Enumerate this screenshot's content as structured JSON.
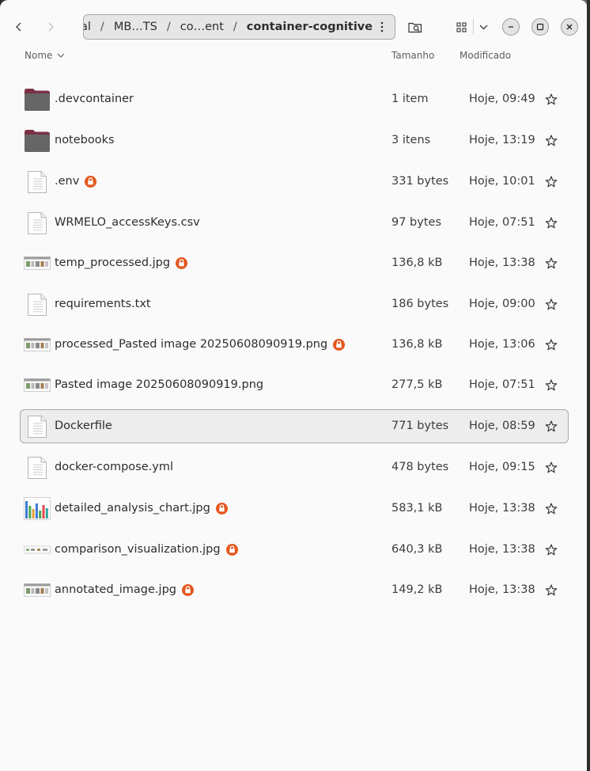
{
  "app": {
    "title": "container-cognitive",
    "accent": "#e5581f"
  },
  "header": {
    "back_icon": "chevron-left-icon",
    "forward_icon": "chevron-right-icon",
    "breadcrumb": [
      "al",
      "MB…TS",
      "co…ent",
      "container-cognitive"
    ],
    "separator": "/",
    "menu_icon": "vertical-dots-icon",
    "search_icon": "search-folder-icon",
    "view_icon": "grid-view-icon",
    "view_dropdown_icon": "chevron-down-icon",
    "window_controls": [
      "minimize-icon",
      "maximize-icon",
      "close-icon"
    ]
  },
  "columns": {
    "name": "Nome",
    "size": "Tamanho",
    "modified": "Modificado",
    "sort_icon": "chevron-down-icon"
  },
  "files": [
    {
      "name": ".devcontainer",
      "type": "folder",
      "size": "1 item",
      "modified": "Hoje, 09:49",
      "locked": false
    },
    {
      "name": "notebooks",
      "type": "folder",
      "size": "3 itens",
      "modified": "Hoje, 13:19",
      "locked": false
    },
    {
      "name": ".env",
      "type": "text",
      "size": "331 bytes",
      "modified": "Hoje, 10:01",
      "locked": true
    },
    {
      "name": "WRMELO_accessKeys.csv",
      "type": "text",
      "size": "97 bytes",
      "modified": "Hoje, 07:51",
      "locked": false
    },
    {
      "name": "temp_processed.jpg",
      "type": "image",
      "size": "136,8 kB",
      "modified": "Hoje, 13:38",
      "locked": true
    },
    {
      "name": "requirements.txt",
      "type": "text",
      "size": "186 bytes",
      "modified": "Hoje, 09:00",
      "locked": false
    },
    {
      "name": "processed_Pasted image 20250608090919.png",
      "type": "image",
      "size": "136,8 kB",
      "modified": "Hoje, 13:06",
      "locked": true
    },
    {
      "name": "Pasted image 20250608090919.png",
      "type": "image",
      "size": "277,5 kB",
      "modified": "Hoje, 07:51",
      "locked": false
    },
    {
      "name": "Dockerfile",
      "type": "text",
      "size": "771 bytes",
      "modified": "Hoje, 08:59",
      "locked": false,
      "selected": true
    },
    {
      "name": "docker-compose.yml",
      "type": "text",
      "size": "478 bytes",
      "modified": "Hoje, 09:15",
      "locked": false
    },
    {
      "name": "detailed_analysis_chart.jpg",
      "type": "chart-image",
      "size": "583,1 kB",
      "modified": "Hoje, 13:38",
      "locked": true
    },
    {
      "name": "comparison_visualization.jpg",
      "type": "image-wide",
      "size": "640,3 kB",
      "modified": "Hoje, 13:38",
      "locked": true
    },
    {
      "name": "annotated_image.jpg",
      "type": "image",
      "size": "149,2 kB",
      "modified": "Hoje, 13:38",
      "locked": true
    }
  ]
}
